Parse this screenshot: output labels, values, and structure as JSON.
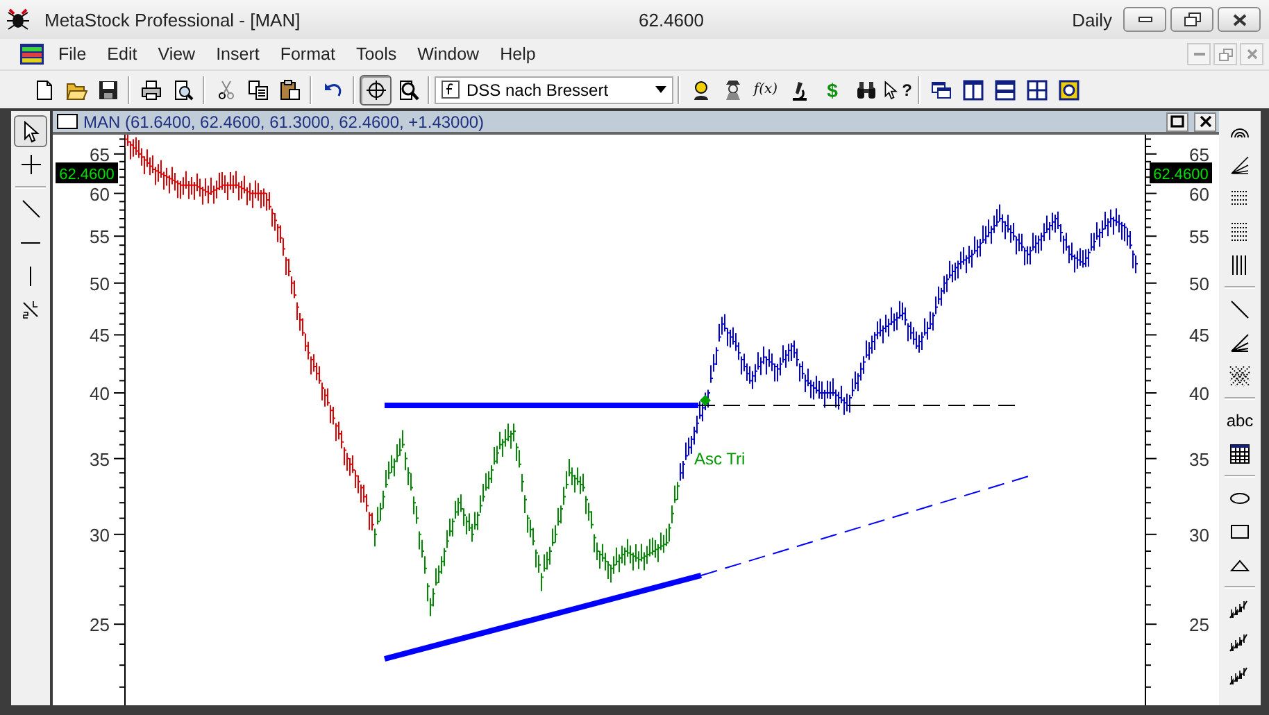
{
  "window": {
    "title": "MetaStock Professional - [MAN]",
    "price": "62.4600",
    "period": "Daily"
  },
  "menu": [
    "File",
    "Edit",
    "View",
    "Insert",
    "Format",
    "Tools",
    "Window",
    "Help"
  ],
  "toolbar": {
    "buttons": [
      {
        "kind": "new",
        "selected": false
      },
      {
        "kind": "open",
        "selected": false
      },
      {
        "kind": "save",
        "selected": false
      },
      {
        "kind": "separator"
      },
      {
        "kind": "print",
        "selected": false
      },
      {
        "kind": "preview",
        "selected": false
      },
      {
        "kind": "separator"
      },
      {
        "kind": "cut",
        "selected": false
      },
      {
        "kind": "copy",
        "selected": false
      },
      {
        "kind": "paste",
        "selected": false
      },
      {
        "kind": "separator"
      },
      {
        "kind": "undo",
        "selected": false
      },
      {
        "kind": "separator"
      },
      {
        "kind": "crosshair",
        "selected": true
      },
      {
        "kind": "zoom",
        "selected": false
      },
      {
        "kind": "separator"
      },
      {
        "kind": "dropdown",
        "value": "DSS nach Bressert"
      },
      {
        "kind": "separator"
      },
      {
        "kind": "expert",
        "selected": false
      },
      {
        "kind": "inspector",
        "selected": false
      },
      {
        "kind": "glyph",
        "label": "f(x)",
        "selected": false
      },
      {
        "kind": "explorer",
        "selected": false
      },
      {
        "kind": "glyph",
        "label": "$",
        "selected": false
      },
      {
        "kind": "binoculars",
        "selected": false
      },
      {
        "kind": "help",
        "label": "?",
        "selected": false
      },
      {
        "kind": "separator"
      },
      {
        "kind": "windows",
        "selected": false
      },
      {
        "kind": "tile-v",
        "selected": false
      },
      {
        "kind": "tile-h",
        "selected": false
      },
      {
        "kind": "tile",
        "selected": false
      },
      {
        "kind": "gear",
        "selected": false
      }
    ]
  },
  "left_tools": [
    {
      "kind": "pointer",
      "selected": true
    },
    {
      "kind": "cross",
      "selected": false
    },
    {
      "kind": "separator"
    },
    {
      "kind": "diag",
      "selected": false
    },
    {
      "kind": "hline",
      "selected": false
    },
    {
      "kind": "vline",
      "selected": false
    },
    {
      "kind": "split",
      "selected": false
    }
  ],
  "right_tools": [
    {
      "kind": "arcs",
      "selected": false
    },
    {
      "kind": "fan",
      "selected": false
    },
    {
      "kind": "dotlines",
      "selected": false
    },
    {
      "kind": "dotlines2",
      "selected": false
    },
    {
      "kind": "vlines",
      "selected": false
    },
    {
      "kind": "separator"
    },
    {
      "kind": "diag",
      "selected": false
    },
    {
      "kind": "fan2",
      "selected": false
    },
    {
      "kind": "lattice",
      "selected": false
    },
    {
      "kind": "separator"
    },
    {
      "kind": "glyph",
      "label": "abc",
      "selected": false
    },
    {
      "kind": "table",
      "selected": false
    },
    {
      "kind": "separator"
    },
    {
      "kind": "ellipse",
      "selected": false
    },
    {
      "kind": "rect",
      "selected": false
    },
    {
      "kind": "triangle",
      "selected": false
    },
    {
      "kind": "separator"
    },
    {
      "kind": "stairs",
      "selected": false
    },
    {
      "kind": "stairs",
      "selected": false
    },
    {
      "kind": "stairs",
      "selected": false
    }
  ],
  "chart_window": {
    "title": "MAN (61.6400, 62.4600, 61.3000, 62.4600, +1.43000)",
    "price_tags": [
      "62.4600",
      "62.4600"
    ],
    "left_axis_labels": [
      "65",
      "60",
      "55",
      "50",
      "45",
      "40",
      "35",
      "30",
      "25"
    ],
    "right_axis_labels": [
      "65",
      "60",
      "55",
      "50",
      "45",
      "40",
      "35",
      "30",
      "25"
    ],
    "pattern_label": "Asc Tri"
  }
}
